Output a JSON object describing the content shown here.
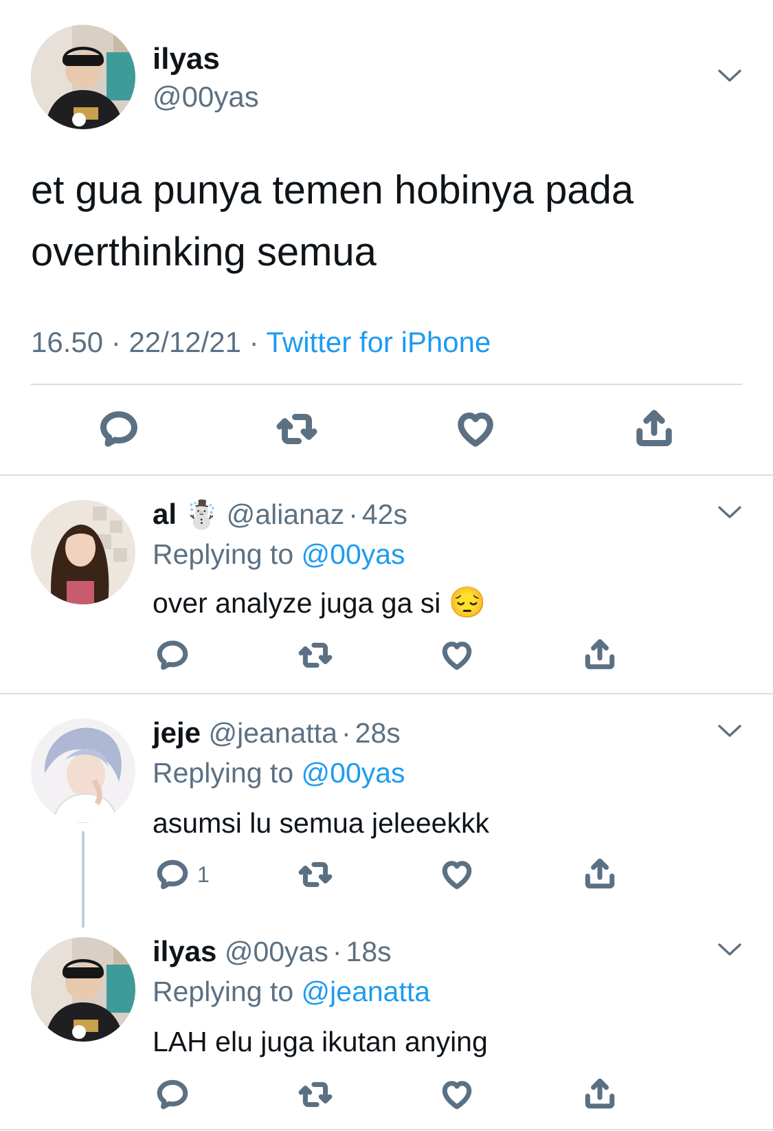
{
  "main_tweet": {
    "display_name": "ilyas",
    "handle": "@00yas",
    "text_line1": "et gua punya temen hobinya pada",
    "text_line2": "overthinking semua",
    "time": "16.50",
    "date": "22/12/21",
    "separator": "·",
    "client": "Twitter for iPhone"
  },
  "replies": [
    {
      "display_name": "al",
      "emoji": "☃️",
      "handle": "@alianaz",
      "separator": "·",
      "age": "42s",
      "replying_label": "Replying to",
      "replying_to": "@00yas",
      "text": "over analyze juga ga si",
      "text_emoji": "😔",
      "reply_count": ""
    },
    {
      "display_name": "jeje",
      "handle": "@jeanatta",
      "separator": "·",
      "age": "28s",
      "replying_label": "Replying to",
      "replying_to": "@00yas",
      "text": "asumsi lu semua jeleeekkk",
      "reply_count": "1"
    },
    {
      "display_name": "ilyas",
      "handle": "@00yas",
      "separator": "·",
      "age": "18s",
      "replying_label": "Replying to",
      "replying_to": "@jeanatta",
      "text": "LAH elu juga ikutan anying",
      "reply_count": ""
    }
  ],
  "icons": {
    "reply": "speech-bubble-icon",
    "retweet": "retweet-icon",
    "like": "heart-icon",
    "share": "share-icon",
    "more": "chevron-down-icon"
  },
  "colors": {
    "link": "#1d9bf0",
    "secondary_text": "#5b7083",
    "divider": "#d9dde1"
  }
}
